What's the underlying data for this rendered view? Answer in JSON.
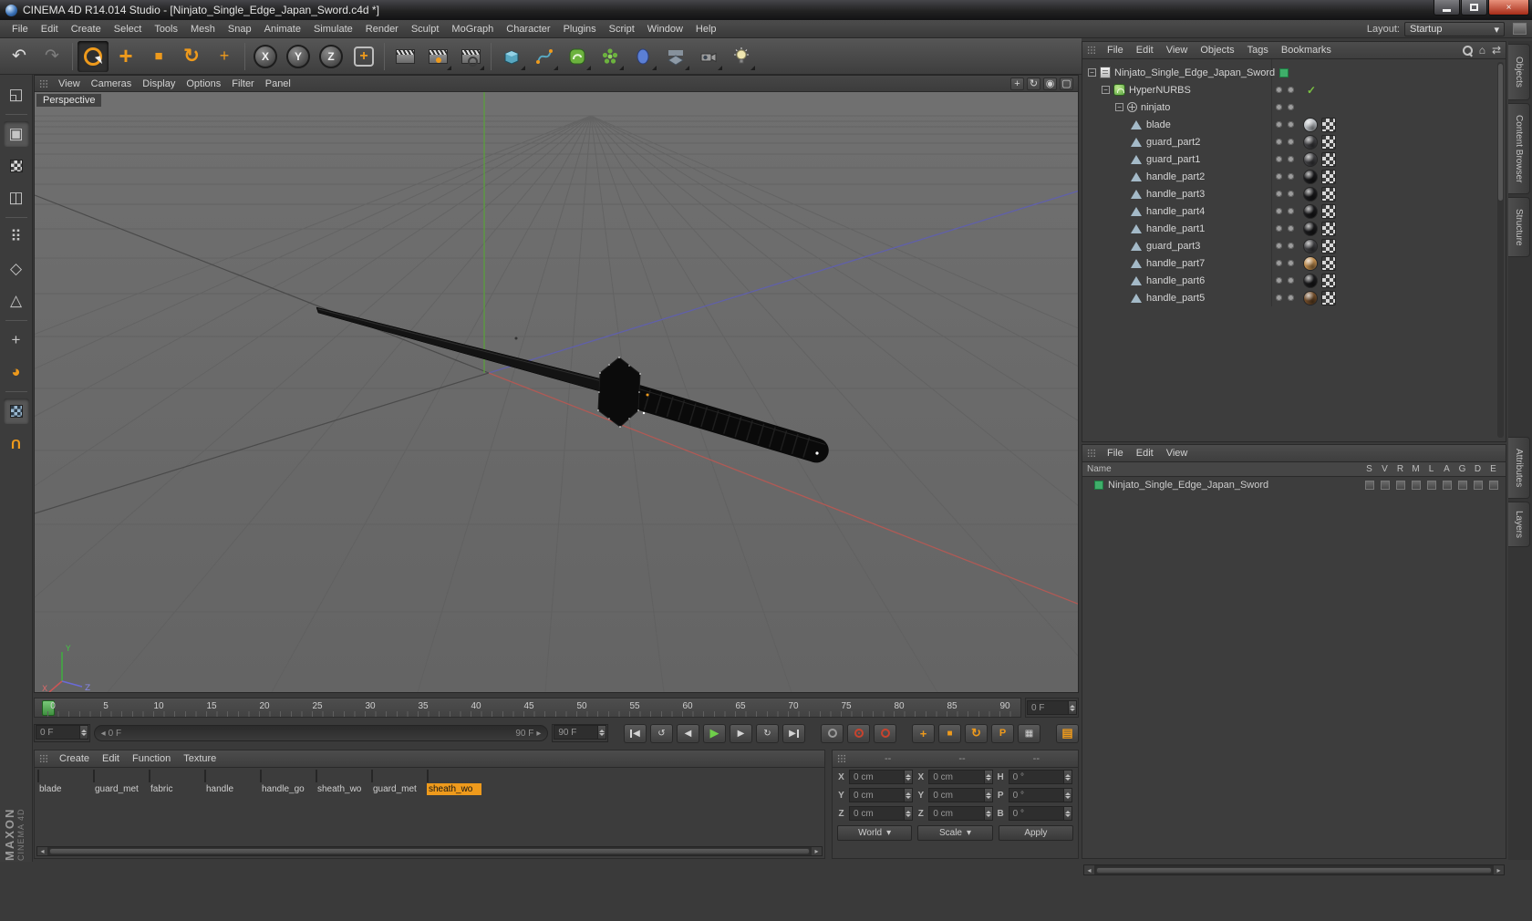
{
  "window": {
    "title": "CINEMA 4D R14.014 Studio - [Ninjato_Single_Edge_Japan_Sword.c4d *]"
  },
  "menubar": {
    "items": [
      "File",
      "Edit",
      "Create",
      "Select",
      "Tools",
      "Mesh",
      "Snap",
      "Animate",
      "Simulate",
      "Render",
      "Sculpt",
      "MoGraph",
      "Character",
      "Plugins",
      "Script",
      "Window",
      "Help"
    ],
    "layout_label": "Layout:",
    "layout_value": "Startup"
  },
  "toolbar": {
    "axis_x": "X",
    "axis_y": "Y",
    "axis_z": "Z"
  },
  "viewport": {
    "menus": [
      "View",
      "Cameras",
      "Display",
      "Options",
      "Filter",
      "Panel"
    ],
    "view_label": "Perspective",
    "axis_labels": {
      "x": "X",
      "y": "Y",
      "z": "Z"
    }
  },
  "objects_panel": {
    "menus": [
      "File",
      "Edit",
      "View",
      "Objects",
      "Tags",
      "Bookmarks"
    ],
    "tree": [
      {
        "label": "Ninjato_Single_Edge_Japan_Sword"
      },
      {
        "label": "HyperNURBS"
      },
      {
        "label": "ninjato"
      },
      {
        "label": "blade",
        "mat": "#b9bdc1"
      },
      {
        "label": "guard_part2",
        "mat": "#404043"
      },
      {
        "label": "guard_part1",
        "mat": "#404043"
      },
      {
        "label": "handle_part2",
        "mat": "#1a1a1c"
      },
      {
        "label": "handle_part3",
        "mat": "#1a1a1c"
      },
      {
        "label": "handle_part4",
        "mat": "#1a1a1c"
      },
      {
        "label": "handle_part1",
        "mat": "#1a1a1c"
      },
      {
        "label": "guard_part3",
        "mat": "#404043"
      },
      {
        "label": "handle_part7",
        "mat": "#bc8b4e"
      },
      {
        "label": "handle_part6",
        "mat": "#1a1a1c"
      },
      {
        "label": "handle_part5",
        "mat": "#6e4a28"
      }
    ]
  },
  "layers_panel": {
    "menus": [
      "File",
      "Edit",
      "View"
    ],
    "name_header": "Name",
    "columns": [
      "S",
      "V",
      "R",
      "M",
      "L",
      "A",
      "G",
      "D",
      "E"
    ],
    "rows": [
      {
        "label": "Ninjato_Single_Edge_Japan_Sword"
      }
    ]
  },
  "timeline": {
    "ticks": [
      "0",
      "5",
      "10",
      "15",
      "20",
      "25",
      "30",
      "35",
      "40",
      "45",
      "50",
      "55",
      "60",
      "65",
      "70",
      "75",
      "80",
      "85",
      "90"
    ],
    "ruler_frame": "0 F",
    "current_frame": "0 F",
    "range_start": "0 F",
    "range_end": "90 F",
    "end_frame": "90 F"
  },
  "materials_panel": {
    "menus": [
      "Create",
      "Edit",
      "Function",
      "Texture"
    ],
    "materials": [
      {
        "name": "blade",
        "color": "#b3b8bc"
      },
      {
        "name": "guard_met",
        "color": "#5f6163"
      },
      {
        "name": "fabric",
        "color": "#161616"
      },
      {
        "name": "handle",
        "color": "#1b1b1d"
      },
      {
        "name": "handle_go",
        "color": "#a8703c"
      },
      {
        "name": "sheath_wo",
        "color": "#2a1f16"
      },
      {
        "name": "guard_met",
        "color": "#8a5c30"
      },
      {
        "name": "sheath_wo",
        "color": "#d9c49c",
        "selected": true
      }
    ]
  },
  "coordinates_panel": {
    "headers": [
      "--",
      "--",
      "--"
    ],
    "rows": [
      {
        "l1": "X",
        "v1": "0 cm",
        "l2": "X",
        "v2": "0 cm",
        "l3": "H",
        "v3": "0 °"
      },
      {
        "l1": "Y",
        "v1": "0 cm",
        "l2": "Y",
        "v2": "0 cm",
        "l3": "P",
        "v3": "0 °"
      },
      {
        "l1": "Z",
        "v1": "0 cm",
        "l2": "Z",
        "v2": "0 cm",
        "l3": "B",
        "v3": "0 °"
      }
    ],
    "system": "World",
    "mode": "Scale",
    "apply": "Apply"
  },
  "side_tabs": [
    "Objects",
    "Content Browser",
    "Structure",
    "Attributes",
    "Layers"
  ],
  "branding": {
    "line1": "MAXON",
    "line2": "CINEMA 4D"
  },
  "icons": {
    "undo": "↶",
    "redo": "↷",
    "collapse": "−",
    "check": "✓",
    "play": "▶",
    "prev": "◀",
    "next": "▶",
    "loop": "↻",
    "loop_b": "↺",
    "dropdown": "▾",
    "home": "⌂",
    "swap": "⇄",
    "left": "◂",
    "right": "▸",
    "grid": "▦",
    "p": "P",
    "plus": "+",
    "square": "■",
    "rotate": "↻",
    "palette": "▤",
    "box": "▢",
    "circle": "◉",
    "min": "−",
    "make_editable": "◱",
    "model": "▣",
    "workplane": "◫",
    "points": "⠿",
    "edges": "◇",
    "polygons": "△",
    "paint": "◕",
    "magnet": "U"
  }
}
